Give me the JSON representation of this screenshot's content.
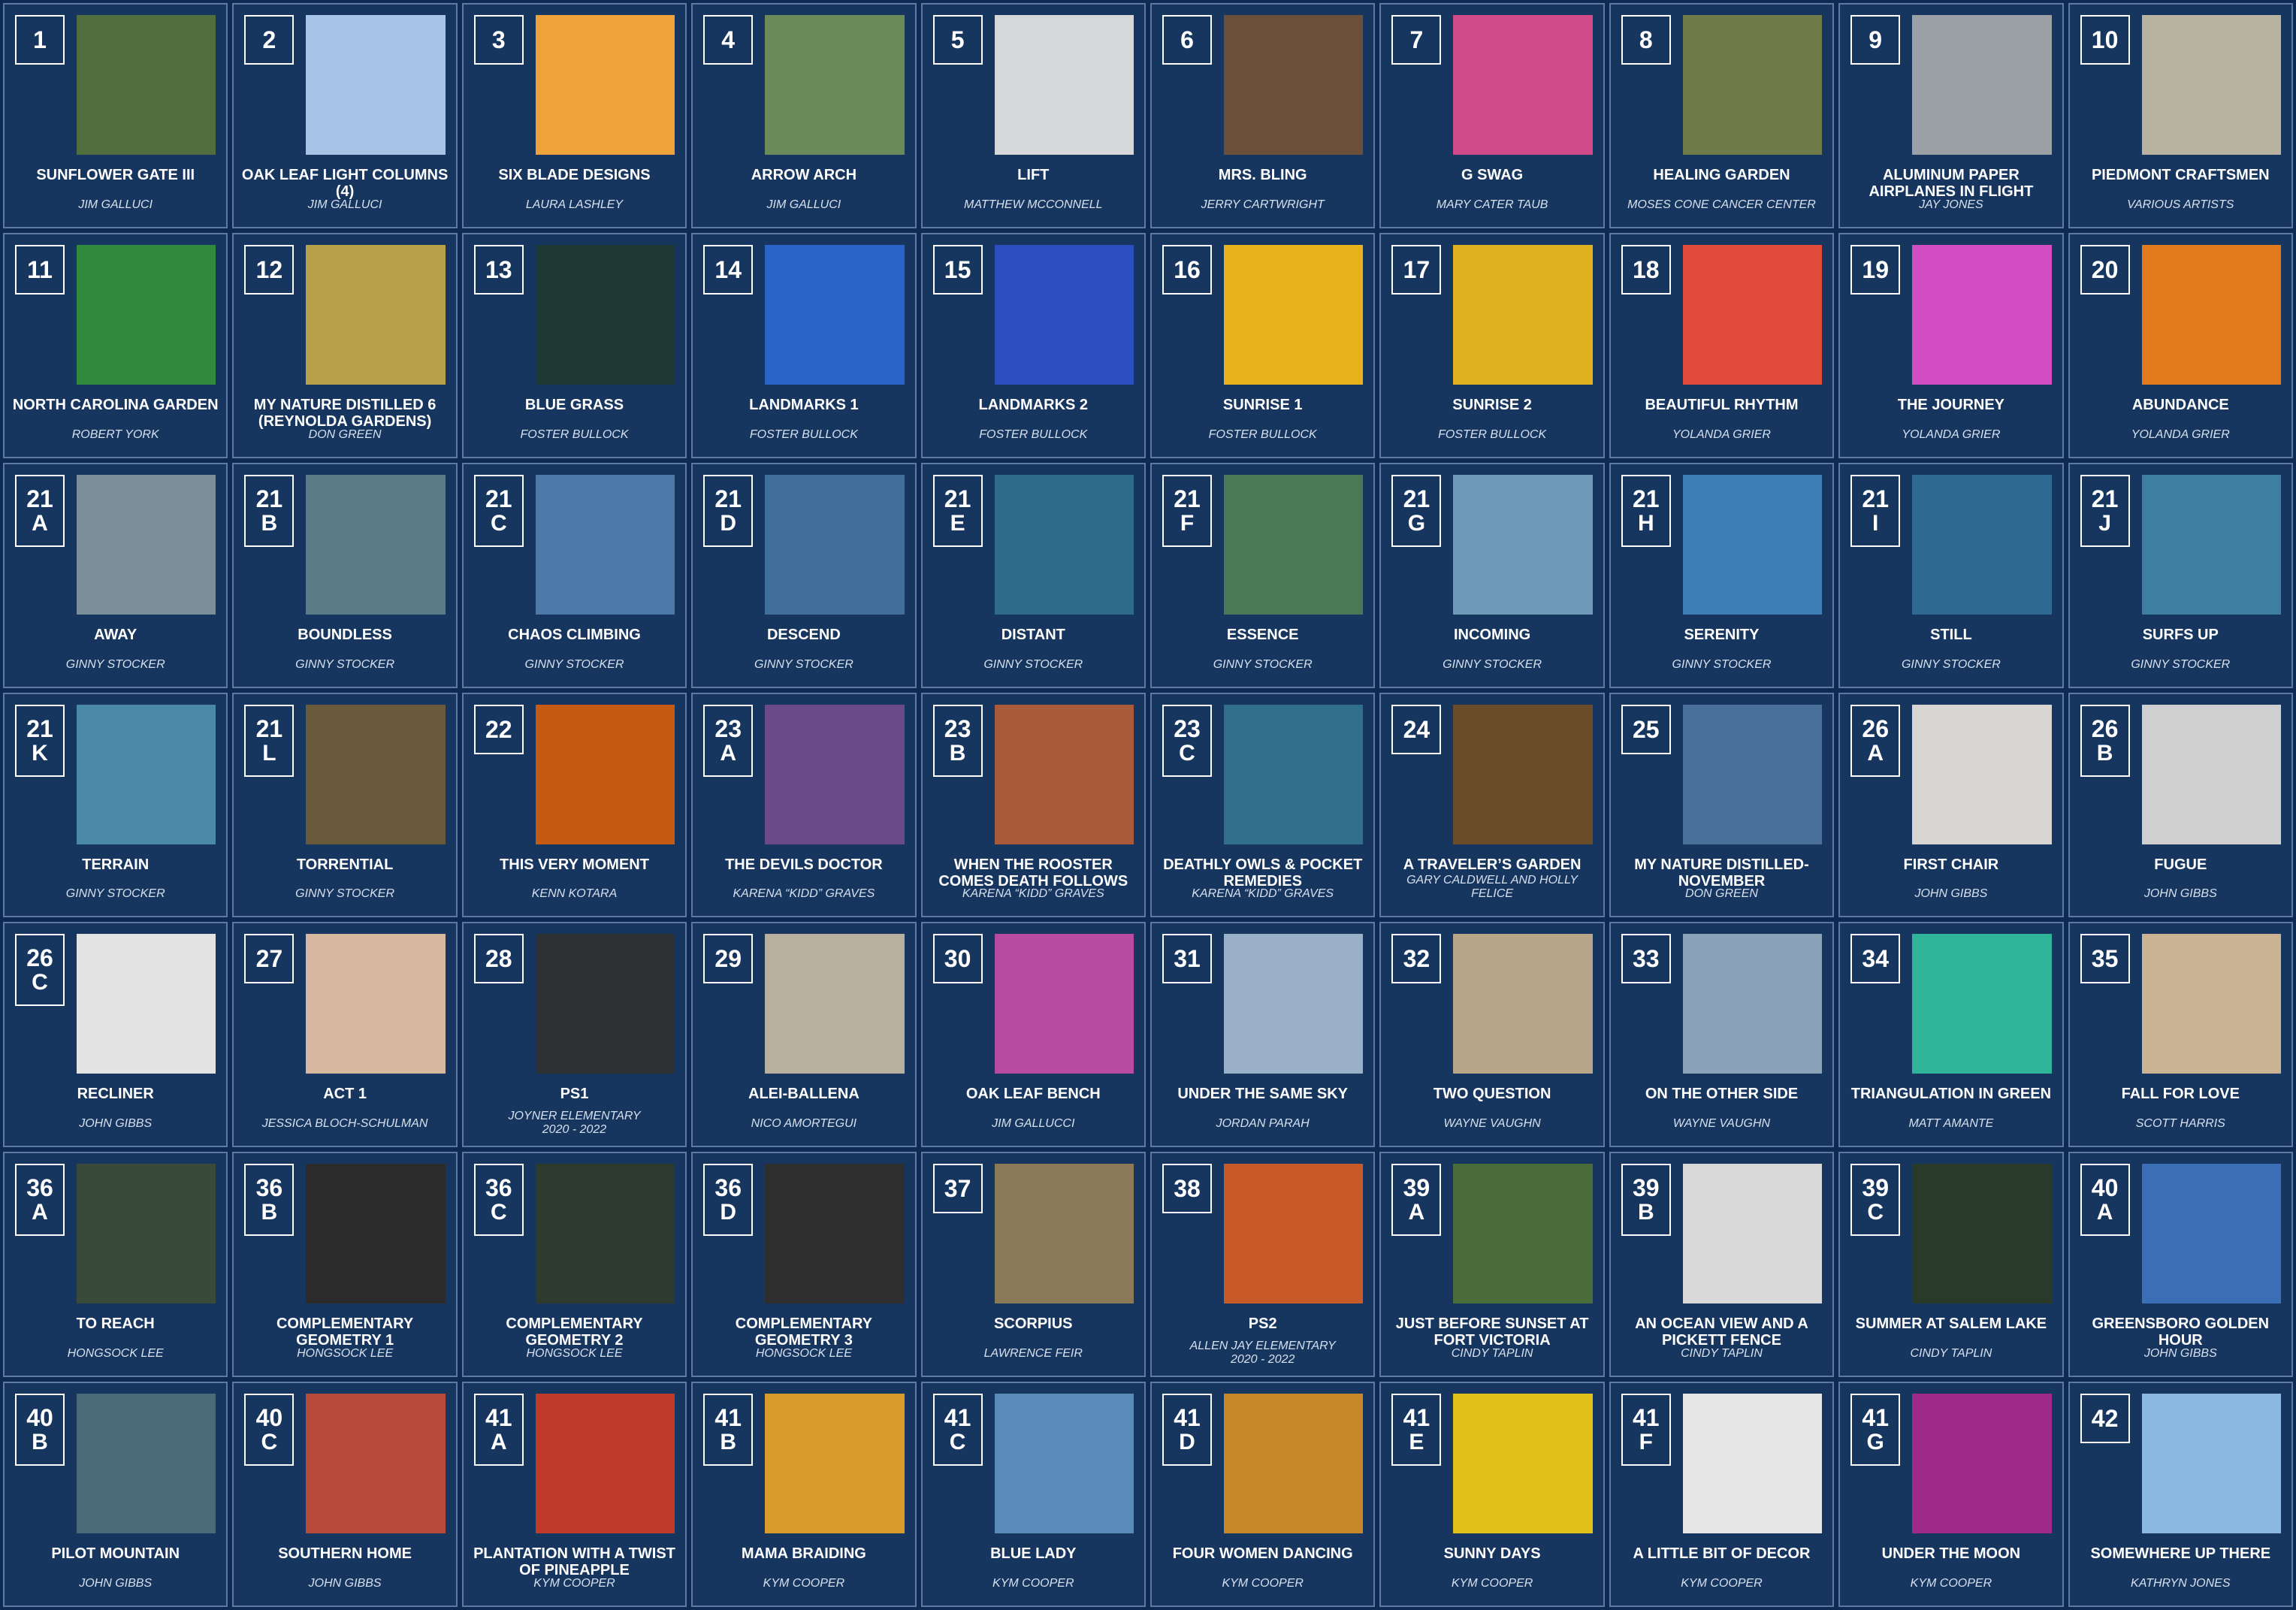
{
  "tiles": [
    {
      "num": "1",
      "sub": "",
      "title": "SUNFLOWER GATE III",
      "artist": "JIM GALLUCI",
      "thumb": "#4f6d3d"
    },
    {
      "num": "2",
      "sub": "",
      "title": "OAK LEAF LIGHT COLUMNS (4)",
      "artist": "JIM GALLUCI",
      "thumb": "#a7c4e6"
    },
    {
      "num": "3",
      "sub": "",
      "title": "SIX BLADE DESIGNS",
      "artist": "LAURA LASHLEY",
      "thumb": "#f0a23a"
    },
    {
      "num": "4",
      "sub": "",
      "title": "ARROW ARCH",
      "artist": "JIM GALLUCI",
      "thumb": "#6a8a5a"
    },
    {
      "num": "5",
      "sub": "",
      "title": "LIFT",
      "artist": "MATTHEW MCCONNELL",
      "thumb": "#d5d7d8"
    },
    {
      "num": "6",
      "sub": "",
      "title": "MRS. BLING",
      "artist": "JERRY CARTWRIGHT",
      "thumb": "#6b4f3a"
    },
    {
      "num": "7",
      "sub": "",
      "title": "G SWAG",
      "artist": "MARY CATER TAUB",
      "thumb": "#d04a8a"
    },
    {
      "num": "8",
      "sub": "",
      "title": "HEALING GARDEN",
      "artist": "MOSES CONE CANCER CENTER",
      "thumb": "#6f7c4a"
    },
    {
      "num": "9",
      "sub": "",
      "title": "ALUMINUM PAPER AIRPLANES IN FLIGHT",
      "artist": "JAY JONES",
      "thumb": "#9aa0a6"
    },
    {
      "num": "10",
      "sub": "",
      "title": "PIEDMONT CRAFTSMEN",
      "artist": "VARIOUS ARTISTS",
      "thumb": "#b8b2a0"
    },
    {
      "num": "11",
      "sub": "",
      "title": "NORTH CAROLINA GARDEN",
      "artist": "ROBERT YORK",
      "thumb": "#2f8a3e"
    },
    {
      "num": "12",
      "sub": "",
      "title": "MY NATURE DISTILLED 6 (REYNOLDA GARDENS)",
      "artist": "DON GREEN",
      "thumb": "#b9a14a"
    },
    {
      "num": "13",
      "sub": "",
      "title": "BLUE GRASS",
      "artist": "FOSTER BULLOCK",
      "thumb": "#1f3a34"
    },
    {
      "num": "14",
      "sub": "",
      "title": "LANDMARKS 1",
      "artist": "FOSTER BULLOCK",
      "thumb": "#2b63c6"
    },
    {
      "num": "15",
      "sub": "",
      "title": "LANDMARKS 2",
      "artist": "FOSTER BULLOCK",
      "thumb": "#2b4fc0"
    },
    {
      "num": "16",
      "sub": "",
      "title": "SUNRISE 1",
      "artist": "FOSTER BULLOCK",
      "thumb": "#e7b21b"
    },
    {
      "num": "17",
      "sub": "",
      "title": "SUNRISE 2",
      "artist": "FOSTER BULLOCK",
      "thumb": "#e0b11f"
    },
    {
      "num": "18",
      "sub": "",
      "title": "BEAUTIFUL RHYTHM",
      "artist": "YOLANDA GRIER",
      "thumb": "#e24a3a"
    },
    {
      "num": "19",
      "sub": "",
      "title": "THE JOURNEY",
      "artist": "YOLANDA GRIER",
      "thumb": "#d24cc2"
    },
    {
      "num": "20",
      "sub": "",
      "title": "ABUNDANCE",
      "artist": "YOLANDA GRIER",
      "thumb": "#e07a1c"
    },
    {
      "num": "21",
      "sub": "A",
      "title": "AWAY",
      "artist": "GINNY STOCKER",
      "thumb": "#7a8f99"
    },
    {
      "num": "21",
      "sub": "B",
      "title": "BOUNDLESS",
      "artist": "GINNY STOCKER",
      "thumb": "#5b7b86"
    },
    {
      "num": "21",
      "sub": "C",
      "title": "CHAOS CLIMBING",
      "artist": "GINNY STOCKER",
      "thumb": "#4c79a8"
    },
    {
      "num": "21",
      "sub": "D",
      "title": "DESCEND",
      "artist": "GINNY STOCKER",
      "thumb": "#3f6f9a"
    },
    {
      "num": "21",
      "sub": "E",
      "title": "DISTANT",
      "artist": "GINNY STOCKER",
      "thumb": "#2f6b8a"
    },
    {
      "num": "21",
      "sub": "F",
      "title": "ESSENCE",
      "artist": "GINNY STOCKER",
      "thumb": "#4a7a55"
    },
    {
      "num": "21",
      "sub": "G",
      "title": "INCOMING",
      "artist": "GINNY STOCKER",
      "thumb": "#6f9ab8"
    },
    {
      "num": "21",
      "sub": "H",
      "title": "SERENITY",
      "artist": "GINNY STOCKER",
      "thumb": "#3f7fb6"
    },
    {
      "num": "21",
      "sub": "I",
      "title": "STILL",
      "artist": "GINNY STOCKER",
      "thumb": "#2f6a92"
    },
    {
      "num": "21",
      "sub": "J",
      "title": "SURFS UP",
      "artist": "GINNY STOCKER",
      "thumb": "#3e7ea0"
    },
    {
      "num": "21",
      "sub": "K",
      "title": "TERRAIN",
      "artist": "GINNY STOCKER",
      "thumb": "#4a88a8"
    },
    {
      "num": "21",
      "sub": "L",
      "title": "TORRENTIAL",
      "artist": "GINNY STOCKER",
      "thumb": "#6a5a3c"
    },
    {
      "num": "22",
      "sub": "",
      "title": "THIS VERY MOMENT",
      "artist": "KENN KOTARA",
      "thumb": "#c55a12"
    },
    {
      "num": "23",
      "sub": "A",
      "title": "THE DEVILS DOCTOR",
      "artist": "KARENA “KIDD” GRAVES",
      "thumb": "#6b4a8a"
    },
    {
      "num": "23",
      "sub": "B",
      "title": "WHEN THE ROOSTER COMES DEATH FOLLOWS",
      "artist": "KARENA “KIDD” GRAVES",
      "thumb": "#a85a3a"
    },
    {
      "num": "23",
      "sub": "C",
      "title": "DEATHLY OWLS & POCKET REMEDIES",
      "artist": "KARENA “KIDD” GRAVES",
      "thumb": "#2f6f8a"
    },
    {
      "num": "24",
      "sub": "",
      "title": "A TRAVELER’S GARDEN",
      "artist": "GARY CALDWELL AND HOLLY FELICE",
      "thumb": "#6a4b2a"
    },
    {
      "num": "25",
      "sub": "",
      "title": "MY NATURE DISTILLED- NOVEMBER",
      "artist": "DON GREEN",
      "thumb": "#4a6f9a"
    },
    {
      "num": "26",
      "sub": "A",
      "title": "FIRST CHAIR",
      "artist": "JOHN GIBBS",
      "thumb": "#d8d6d2"
    },
    {
      "num": "26",
      "sub": "B",
      "title": "FUGUE",
      "artist": "JOHN GIBBS",
      "thumb": "#cfcfcf"
    },
    {
      "num": "26",
      "sub": "C",
      "title": "RECLINER",
      "artist": "JOHN GIBBS",
      "thumb": "#e3e3e3"
    },
    {
      "num": "27",
      "sub": "",
      "title": "ACT 1",
      "artist": "JESSICA BLOCH-SCHULMAN",
      "thumb": "#d7b79f"
    },
    {
      "num": "28",
      "sub": "",
      "title": "PS1",
      "artist": "JOYNER ELEMENTARY",
      "artist2": "2020 - 2022",
      "thumb": "#2e3134"
    },
    {
      "num": "29",
      "sub": "",
      "title": "ALEI-BALLENA",
      "artist": "NICO AMORTEGUI",
      "thumb": "#b8b09e"
    },
    {
      "num": "30",
      "sub": "",
      "title": "OAK LEAF BENCH",
      "artist": "JIM GALLUCCI",
      "thumb": "#b84aa0"
    },
    {
      "num": "31",
      "sub": "",
      "title": "UNDER THE SAME SKY",
      "artist": "JORDAN PARAH",
      "thumb": "#9ab0c6"
    },
    {
      "num": "32",
      "sub": "",
      "title": "TWO QUESTION",
      "artist": "WAYNE VAUGHN",
      "thumb": "#b7a58a"
    },
    {
      "num": "33",
      "sub": "",
      "title": "ON THE OTHER SIDE",
      "artist": "WAYNE VAUGHN",
      "thumb": "#8ba3b8"
    },
    {
      "num": "34",
      "sub": "",
      "title": "TRIANGULATION IN GREEN",
      "artist": "MATT AMANTE",
      "thumb": "#2fb49a"
    },
    {
      "num": "35",
      "sub": "",
      "title": "FALL FOR LOVE",
      "artist": "SCOTT HARRIS",
      "thumb": "#c9b392"
    },
    {
      "num": "36",
      "sub": "A",
      "title": "TO REACH",
      "artist": "HONGSOCK LEE",
      "thumb": "#3a4a3a"
    },
    {
      "num": "36",
      "sub": "B",
      "title": "COMPLEMENTARY GEOMETRY 1",
      "artist": "HONGSOCK LEE",
      "thumb": "#2b2b2b"
    },
    {
      "num": "36",
      "sub": "C",
      "title": "COMPLEMENTARY GEOMETRY 2",
      "artist": "HONGSOCK LEE",
      "thumb": "#2f3a2f"
    },
    {
      "num": "36",
      "sub": "D",
      "title": "COMPLEMENTARY GEOMETRY 3",
      "artist": "HONGSOCK LEE",
      "thumb": "#2e2e2e"
    },
    {
      "num": "37",
      "sub": "",
      "title": "SCORPIUS",
      "artist": "LAWRENCE FEIR",
      "thumb": "#8a7a5a"
    },
    {
      "num": "38",
      "sub": "",
      "title": "PS2",
      "artist": "ALLEN JAY ELEMENTARY",
      "artist2": "2020 - 2022",
      "thumb": "#c85a2a"
    },
    {
      "num": "39",
      "sub": "A",
      "title": "JUST BEFORE SUNSET AT FORT VICTORIA",
      "artist": "CINDY TAPLIN",
      "thumb": "#4a6b3a"
    },
    {
      "num": "39",
      "sub": "B",
      "title": "AN OCEAN VIEW AND A PICKETT FENCE",
      "artist": "CINDY TAPLIN",
      "thumb": "#d9d9d9"
    },
    {
      "num": "39",
      "sub": "C",
      "title": "SUMMER AT SALEM LAKE",
      "artist": "CINDY TAPLIN",
      "thumb": "#2a3a2a"
    },
    {
      "num": "40",
      "sub": "A",
      "title": "GREENSBORO GOLDEN HOUR",
      "artist": "JOHN GIBBS",
      "thumb": "#3a6fb6"
    },
    {
      "num": "40",
      "sub": "B",
      "title": "PILOT MOUNTAIN",
      "artist": "JOHN GIBBS",
      "thumb": "#4a6a7a"
    },
    {
      "num": "40",
      "sub": "C",
      "title": "SOUTHERN HOME",
      "artist": "JOHN GIBBS",
      "thumb": "#b84a3a"
    },
    {
      "num": "41",
      "sub": "A",
      "title": "PLANTATION WITH A TWIST OF PINEAPPLE",
      "artist": "KYM COOPER",
      "thumb": "#c0392b"
    },
    {
      "num": "41",
      "sub": "B",
      "title": "MAMA BRAIDING",
      "artist": "KYM COOPER",
      "thumb": "#d89a2a"
    },
    {
      "num": "41",
      "sub": "C",
      "title": "BLUE LADY",
      "artist": "KYM COOPER",
      "thumb": "#5a8ab8"
    },
    {
      "num": "41",
      "sub": "D",
      "title": "FOUR WOMEN DANCING",
      "artist": "KYM COOPER",
      "thumb": "#c6882a"
    },
    {
      "num": "41",
      "sub": "E",
      "title": "SUNNY DAYS",
      "artist": "KYM COOPER",
      "thumb": "#e0c21a"
    },
    {
      "num": "41",
      "sub": "F",
      "title": "A LITTLE BIT OF DECOR",
      "artist": "KYM COOPER",
      "thumb": "#e6e6e6"
    },
    {
      "num": "41",
      "sub": "G",
      "title": "UNDER THE MOON",
      "artist": "KYM COOPER",
      "thumb": "#a02a8a"
    },
    {
      "num": "42",
      "sub": "",
      "title": "SOMEWHERE UP THERE",
      "artist": "KATHRYN JONES",
      "thumb": "#8ab8e0"
    }
  ]
}
